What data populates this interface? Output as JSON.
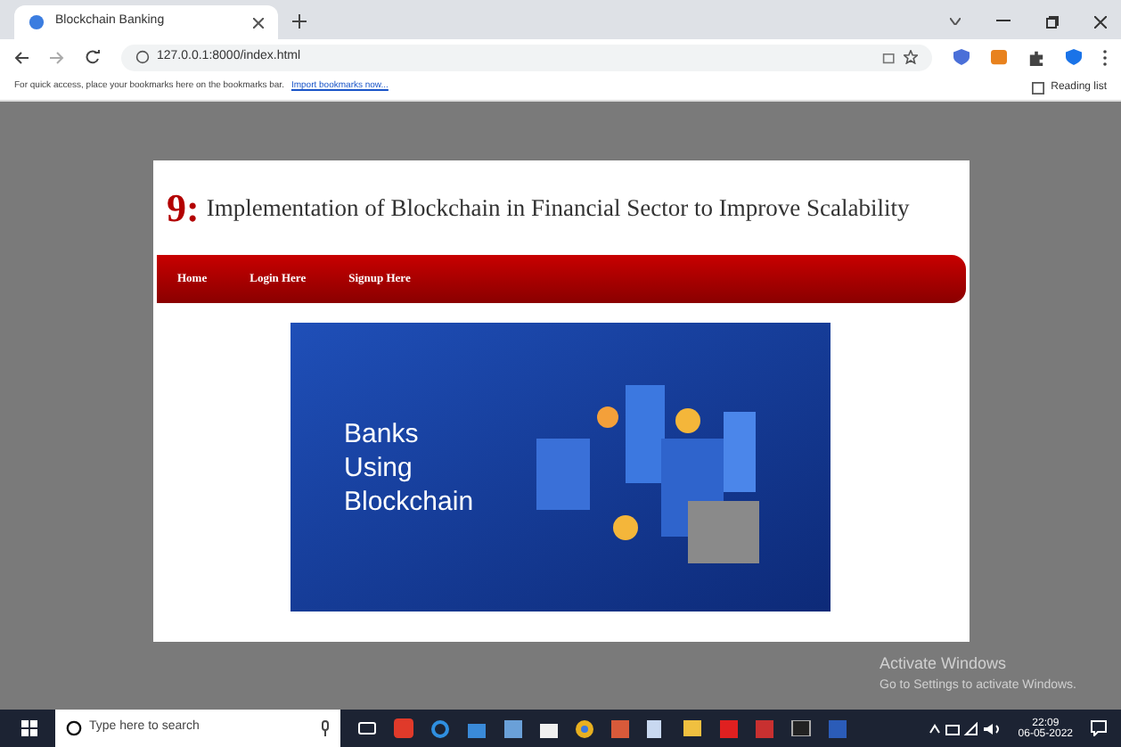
{
  "browser": {
    "tab_title": "Blockchain Banking",
    "url": "127.0.0.1:8000/index.html",
    "bookmarks_hint": "For quick access, place your bookmarks here on the bookmarks bar.",
    "bookmarks_link": "Import bookmarks now...",
    "reading_list": "Reading list"
  },
  "page": {
    "logo": "9:",
    "title": "Implementation of Blockchain in Financial Sector to Improve Scalability",
    "nav": [
      {
        "label": "Home"
      },
      {
        "label": "Login Here"
      },
      {
        "label": "Signup Here"
      }
    ],
    "banner_text": [
      "Banks",
      "Using",
      "Blockchain"
    ]
  },
  "watermark": {
    "title": "Activate Windows",
    "subtitle": "Go to Settings to activate Windows."
  },
  "taskbar": {
    "search_placeholder": "Type here to search",
    "time": "22:09",
    "date": "06-05-2022"
  }
}
